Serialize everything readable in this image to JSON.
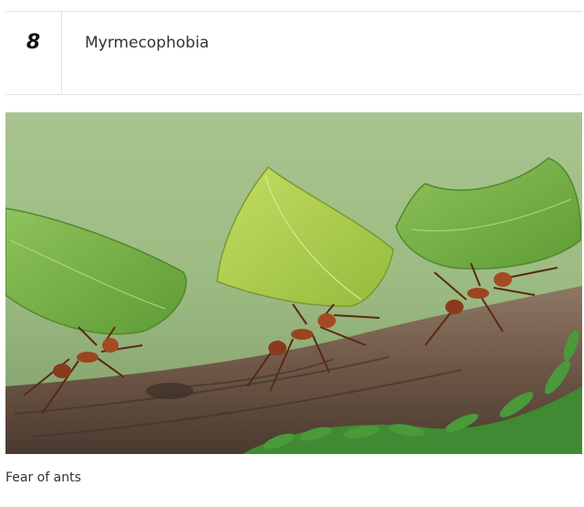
{
  "item": {
    "number": "8",
    "title": "Myrmecophobia"
  },
  "image": {
    "subject": "leafcutter-ants-carrying-leaves"
  },
  "caption": "Fear of ants"
}
